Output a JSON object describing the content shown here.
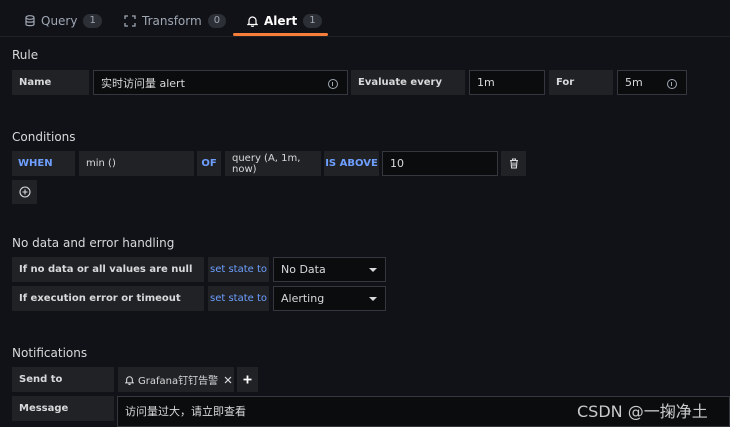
{
  "tabs": [
    {
      "label": "Query",
      "count": "1",
      "icon": "database-icon"
    },
    {
      "label": "Transform",
      "count": "0",
      "icon": "transform-icon"
    },
    {
      "label": "Alert",
      "count": "1",
      "icon": "bell-icon",
      "active": true
    }
  ],
  "rule": {
    "heading": "Rule",
    "name_label": "Name",
    "name_value": "实时访问量 alert",
    "evaluate_label": "Evaluate every",
    "evaluate_value": "1m",
    "for_label": "For",
    "for_value": "5m"
  },
  "conditions": {
    "heading": "Conditions",
    "when": "WHEN",
    "reducer": "min ()",
    "of": "OF",
    "query": "query (A, 1m, now)",
    "evaluator": "IS ABOVE",
    "threshold": "10"
  },
  "no_data": {
    "heading": "No data and error handling",
    "rows": [
      {
        "label": "If no data or all values are null",
        "action": "set state to",
        "value": "No Data"
      },
      {
        "label": "If execution error or timeout",
        "action": "set state to",
        "value": "Alerting"
      }
    ]
  },
  "notifications": {
    "heading": "Notifications",
    "send_to_label": "Send to",
    "channel": "Grafana钉钉告警",
    "message_label": "Message",
    "message_value": "访问量过大，请立即查看"
  },
  "watermark": "CSDN @一掬净土",
  "colors": {
    "accent": "#f77e3a",
    "keyword": "#6e9fff",
    "background": "#111217",
    "panel": "#202226"
  }
}
